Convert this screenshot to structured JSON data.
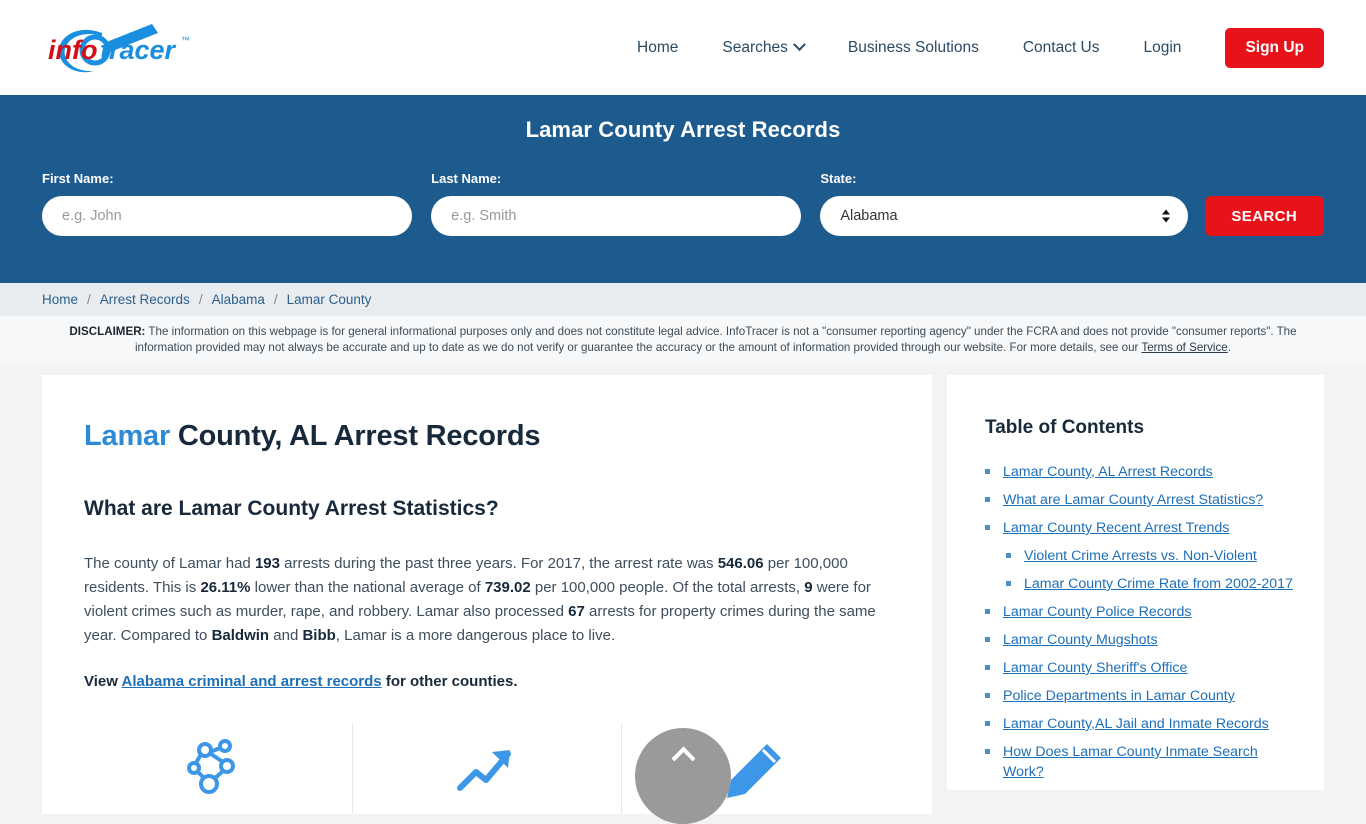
{
  "header": {
    "logo_text": "infotracer",
    "logo_tm": "™",
    "nav": [
      {
        "label": "Home",
        "icon": null
      },
      {
        "label": "Searches",
        "icon": "chevron-down-icon"
      },
      {
        "label": "Business Solutions",
        "icon": null
      },
      {
        "label": "Contact Us",
        "icon": null
      },
      {
        "label": "Login",
        "icon": null
      }
    ],
    "signup_label": "Sign Up",
    "signup_color": "#e8121a"
  },
  "search_banner": {
    "title": "Lamar County Arrest Records",
    "background": "#1d5b8f",
    "first_name_label": "First Name:",
    "first_name_value": "",
    "first_name_placeholder": "e.g. John",
    "last_name_label": "Last Name:",
    "last_name_value": "",
    "last_name_placeholder": "e.g. Smith",
    "state_label": "State:",
    "state_selected": "Alabama",
    "search_button": "SEARCH"
  },
  "breadcrumb": {
    "items": [
      "Home",
      "Arrest Records",
      "Alabama",
      "Lamar County"
    ],
    "separator": "/"
  },
  "disclaimer": {
    "label": "DISCLAIMER:",
    "text": " The information on this webpage is for general informational purposes only and does not constitute legal advice. InfoTracer is not a \"consumer reporting agency\" under the FCRA and does not provide \"consumer reports\". The information provided may not always be accurate and up to date as we do not verify or guarantee the accuracy or the amount of information provided through our website. For more details, see our ",
    "link": "Terms of Service",
    "tail": "."
  },
  "main": {
    "title_highlight": "Lamar",
    "title_rest": " County, AL Arrest Records",
    "section_heading": "What are Lamar County Arrest Statistics?",
    "paragraph": {
      "p1": "The county of Lamar had ",
      "arrests": "193",
      "p2": " arrests during the past three years. For 2017, the arrest rate was ",
      "arrest_rate": "546.06",
      "p3": " per 100,000 residents. This is ",
      "pct_lower": "26.11%",
      "p4": " lower than the national average of ",
      "national_average": "739.02",
      "p5": " per 100,000 people. Of the total arrests, ",
      "violent_count": "9",
      "p6": " were for violent crimes such as murder, rape, and robbery. Lamar also processed ",
      "property_count": "67",
      "p7": " arrests for property crimes during the same year. Compared to ",
      "compare_a": "Baldwin",
      "p8": " and ",
      "compare_b": "Bibb",
      "p9": ", Lamar is a more dangerous place to live."
    },
    "view_prefix": "View ",
    "view_link": "Alabama criminal and arrest records",
    "view_suffix": " for other counties.",
    "icons": [
      "network-nodes-icon",
      "arrow-growth-icon",
      "pen-icon"
    ]
  },
  "toc": {
    "title": "Table of Contents",
    "items": [
      {
        "label": "Lamar County, AL Arrest Records",
        "sub": false
      },
      {
        "label": "What are Lamar County Arrest Statistics?",
        "sub": false
      },
      {
        "label": "Lamar County Recent Arrest Trends",
        "sub": false
      },
      {
        "label": "Violent Crime Arrests vs. Non-Violent",
        "sub": true
      },
      {
        "label": "Lamar County Crime Rate from 2002-2017",
        "sub": true
      },
      {
        "label": "Lamar County Police Records",
        "sub": false
      },
      {
        "label": "Lamar County Mugshots",
        "sub": false
      },
      {
        "label": "Lamar County Sheriff's Office",
        "sub": false
      },
      {
        "label": "Police Departments in Lamar County",
        "sub": false
      },
      {
        "label": "Lamar County,AL Jail and Inmate Records",
        "sub": false
      },
      {
        "label": "How Does Lamar County Inmate Search Work?",
        "sub": false
      }
    ]
  },
  "scroll_top": {
    "icon": "chevron-up-icon"
  }
}
